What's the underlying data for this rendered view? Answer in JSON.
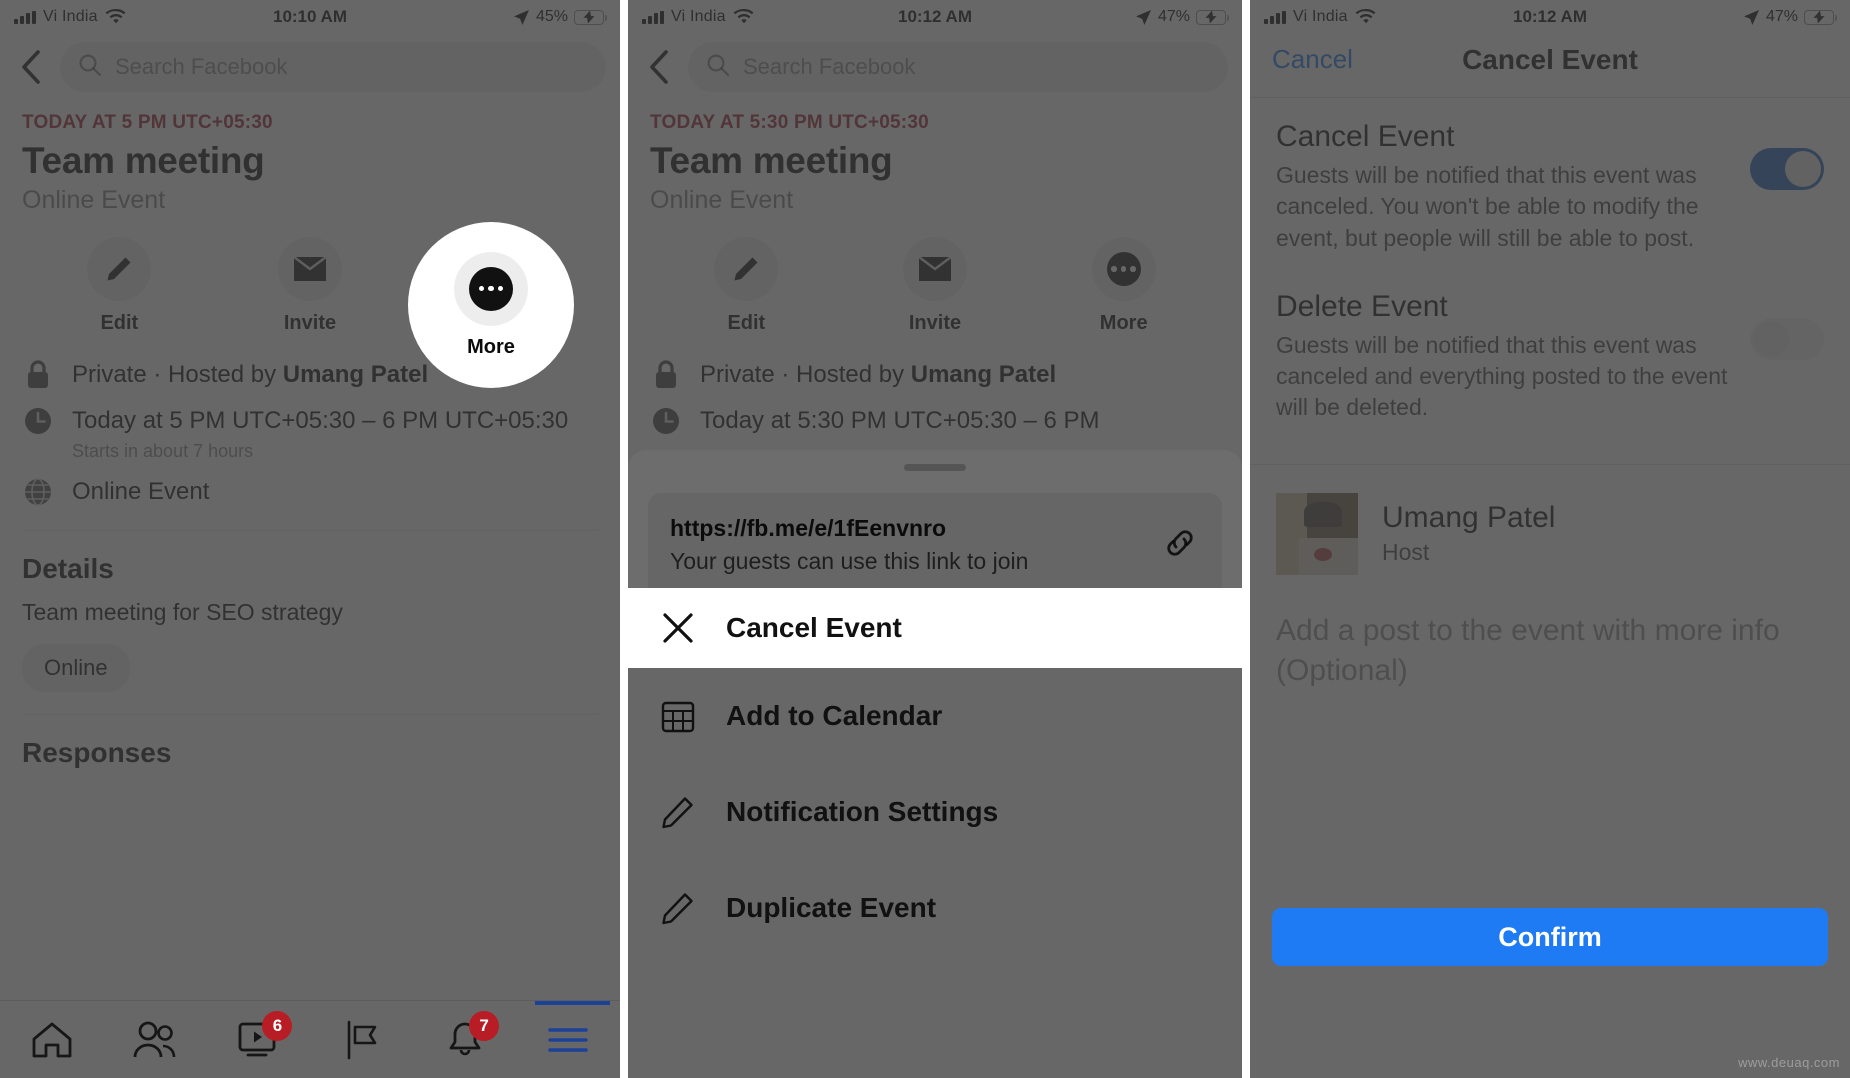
{
  "panel1": {
    "status": {
      "carrier": "Vi India",
      "time": "10:10 AM",
      "battery_pct": "45%",
      "signal_icon": "signal-bars-icon",
      "wifi_icon": "wifi-icon",
      "location_icon": "location-arrow-icon",
      "battery_icon": "battery-charging-icon"
    },
    "topbar": {
      "back_icon": "back-chevron-icon",
      "search_icon": "search-icon",
      "search_placeholder": "Search Facebook"
    },
    "event": {
      "when": "TODAY AT 5 PM UTC+05:30",
      "title": "Team meeting",
      "subtitle": "Online Event"
    },
    "actions": [
      {
        "label": "Edit",
        "icon": "pencil-icon"
      },
      {
        "label": "Invite",
        "icon": "envelope-icon"
      },
      {
        "label": "More",
        "icon": "ellipsis-icon"
      }
    ],
    "info": [
      {
        "icon": "lock-icon",
        "text_pre": "Private · Hosted by ",
        "text_bold": "Umang Patel"
      },
      {
        "icon": "clock-icon",
        "text": "Today at 5 PM UTC+05:30 – 6 PM UTC+05:30",
        "sub": "Starts in about 7 hours"
      },
      {
        "icon": "globe-icon",
        "text": "Online Event"
      }
    ],
    "details": {
      "heading": "Details",
      "body": "Team meeting for SEO strategy",
      "chip": "Online"
    },
    "responses_heading": "Responses",
    "nav": [
      {
        "name": "home",
        "icon": "home-icon",
        "badge": ""
      },
      {
        "name": "friends",
        "icon": "friends-icon",
        "badge": ""
      },
      {
        "name": "watch",
        "icon": "video-play-icon",
        "badge": "6"
      },
      {
        "name": "pages",
        "icon": "flag-icon",
        "badge": ""
      },
      {
        "name": "notifications",
        "icon": "bell-icon",
        "badge": "7"
      },
      {
        "name": "menu",
        "icon": "hamburger-menu-icon",
        "badge": ""
      }
    ]
  },
  "panel2": {
    "status": {
      "carrier": "Vi India",
      "time": "10:12 AM",
      "battery_pct": "47%"
    },
    "topbar": {
      "search_placeholder": "Search Facebook"
    },
    "event": {
      "when": "TODAY AT 5:30 PM UTC+05:30",
      "title": "Team meeting",
      "subtitle": "Online Event"
    },
    "actions": [
      {
        "label": "Edit",
        "icon": "pencil-icon"
      },
      {
        "label": "Invite",
        "icon": "envelope-icon"
      },
      {
        "label": "More",
        "icon": "ellipsis-icon"
      }
    ],
    "info": [
      {
        "icon": "lock-icon",
        "text_pre": "Private · Hosted by ",
        "text_bold": "Umang Patel"
      },
      {
        "icon": "clock-icon",
        "text": "Today at 5:30 PM UTC+05:30 – 6 PM"
      }
    ],
    "link_card": {
      "url": "https://fb.me/e/1fEenvnro",
      "sub": "Your guests can use this link to join",
      "icon": "link-chain-icon"
    },
    "menu": [
      {
        "label": "Cancel Event",
        "icon": "close-x-icon",
        "highlighted": true
      },
      {
        "label": "Add to Calendar",
        "icon": "calendar-icon",
        "highlighted": false
      },
      {
        "label": "Notification Settings",
        "icon": "pencil-icon",
        "highlighted": false
      },
      {
        "label": "Duplicate Event",
        "icon": "pencil-icon",
        "highlighted": false
      }
    ]
  },
  "panel3": {
    "status": {
      "carrier": "Vi India",
      "time": "10:12 AM",
      "battery_pct": "47%"
    },
    "nav": {
      "cancel_label": "Cancel",
      "title": "Cancel Event"
    },
    "options": [
      {
        "title": "Cancel Event",
        "desc": "Guests will be notified that this event was canceled. You won't be able to modify the event, but people will still be able to post.",
        "toggle": "on"
      },
      {
        "title": "Delete Event",
        "desc": "Guests will be notified that this event was canceled and everything posted to the event will be deleted.",
        "toggle": "off"
      }
    ],
    "host": {
      "name": "Umang Patel",
      "role": "Host",
      "avatar_icon": "avatar-photo"
    },
    "composer_placeholder": "Add a post to the event with more info (Optional)",
    "confirm_label": "Confirm"
  },
  "watermark": "www.deuaq.com",
  "colors": {
    "accent_blue": "#1877f2",
    "confirm_blue": "#1f7bf4",
    "event_red": "#9b1b30",
    "badge_red": "#b81c24",
    "toggle_on": "#1b5fbe"
  }
}
